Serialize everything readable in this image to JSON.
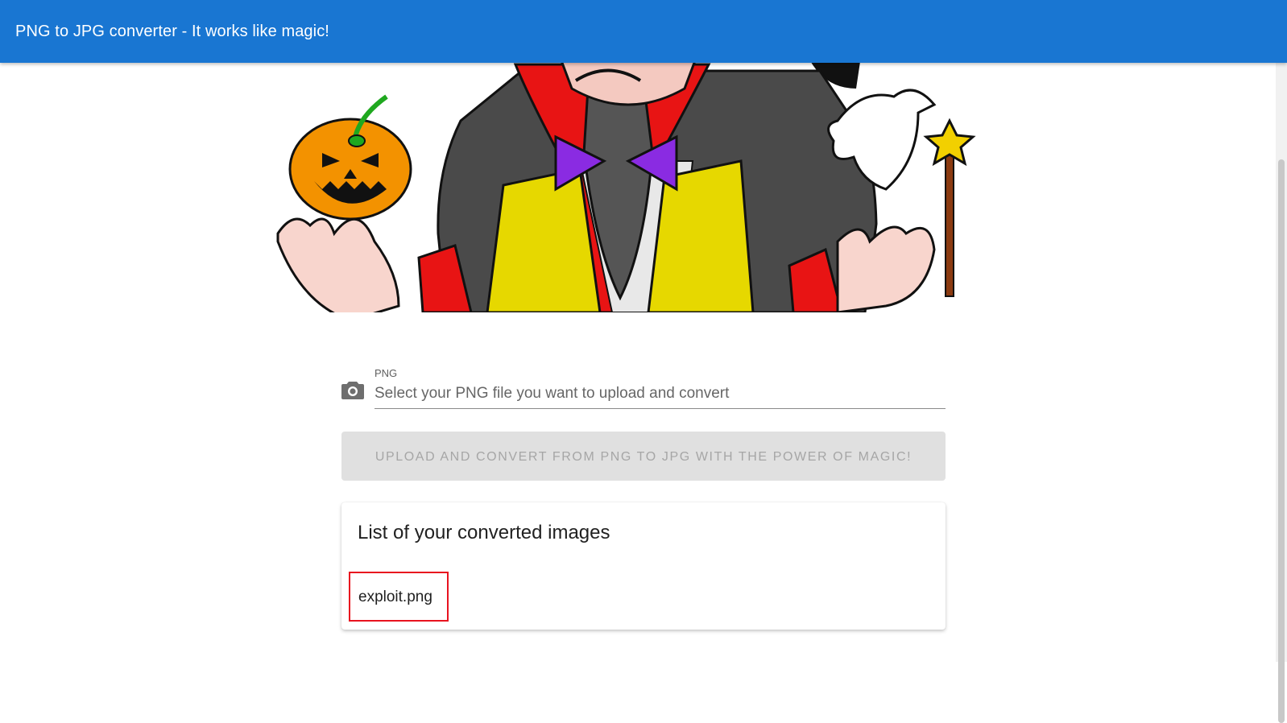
{
  "app_bar": {
    "title": "PNG to JPG converter - It works like magic!",
    "color": "#1976d2"
  },
  "hero": {
    "icon": "magician-illustration"
  },
  "upload": {
    "camera_icon": "camera-icon",
    "field_label": "PNG",
    "field_placeholder": "Select your PNG file you want to upload and convert",
    "button_label": "UPLOAD AND CONVERT FROM PNG TO JPG WITH THE POWER OF MAGIC!"
  },
  "converted_list": {
    "title": "List of your converted images",
    "items": [
      {
        "name": "exploit.png",
        "highlight_color": "#e8131f"
      }
    ]
  }
}
